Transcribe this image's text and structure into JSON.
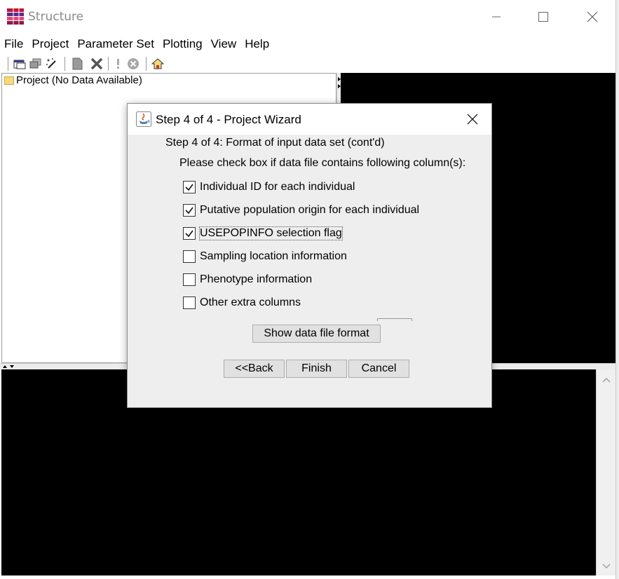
{
  "window": {
    "title": "Structure",
    "minimize_glyph": "—",
    "maximize_glyph": "☐",
    "close_glyph": "✕"
  },
  "menu": [
    "File",
    "Project",
    "Parameter Set",
    "Plotting",
    "View",
    "Help"
  ],
  "toolbar": {
    "icons": [
      "new-project-icon",
      "open-project-icon",
      "wizard-icon",
      "new-parameter-set-icon",
      "delete-icon",
      "run-icon",
      "stop-icon",
      "home-icon"
    ]
  },
  "tree": {
    "root_label": "Project (No Data Available)"
  },
  "dialog": {
    "title": "Step 4 of 4 - Project Wizard",
    "heading": "Step 4 of 4: Format of input data set (cont'd)",
    "instruction": "Please check box if data file contains following column(s):",
    "options": [
      {
        "label": "Individual ID for each individual",
        "checked": true
      },
      {
        "label": "Putative population origin for each individual",
        "checked": true
      },
      {
        "label": "USEPOPINFO selection flag",
        "checked": true
      },
      {
        "label": "Sampling location information",
        "checked": false
      },
      {
        "label": "Phenotype information",
        "checked": false
      },
      {
        "label": "Other extra columns",
        "checked": false
      }
    ],
    "show_format_label": "Show data file format",
    "back_label": "<<Back",
    "finish_label": "Finish",
    "cancel_label": "Cancel"
  },
  "colors": {
    "app_icon_stripes": [
      "#c0143c",
      "#5a2a8a",
      "#e04a7a",
      "#8b1a4a"
    ],
    "folder": "#f6d97c",
    "panel_black": "#000000"
  }
}
